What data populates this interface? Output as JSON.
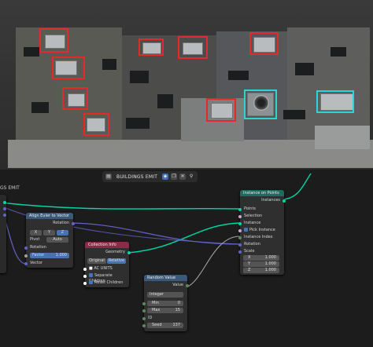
{
  "header": {
    "title": "BUILDINGS EMIT",
    "icons": [
      "node-tree-icon",
      "pin-icon",
      "shield-icon",
      "close-icon"
    ]
  },
  "left_fragment": {
    "label": "GS EMIT"
  },
  "nodes": {
    "instance_on_points": {
      "title": "Instance on Points",
      "output": "Instances",
      "inputs": [
        "Points",
        "Selection",
        "Instance",
        "Pick Instance",
        "Instance Index",
        "Rotation",
        "Scale"
      ],
      "scale": {
        "x_label": "X",
        "x": "1.000",
        "y_label": "Y",
        "y": "1.000",
        "z_label": "Z",
        "z": "1.000"
      }
    },
    "align_euler": {
      "title": "Align Euler to Vector",
      "output": "Rotation",
      "axes": [
        "X",
        "Y",
        "Z"
      ],
      "pivot_label": "Pivot",
      "pivot_value": "Auto",
      "rotation_label": "Rotation",
      "factor_label": "Factor",
      "factor_value": "1.000",
      "vector_label": "Vector"
    },
    "collection_info": {
      "title": "Collection Info",
      "output": "Geometry",
      "tabs": [
        "Original",
        "Relative"
      ],
      "collection": "AC UNITS",
      "separate_children": "Separate Children",
      "reset_children": "Reset Children"
    },
    "random_value": {
      "title": "Random Value",
      "output": "Value",
      "type": "Integer",
      "min_label": "Min",
      "min": "0",
      "max_label": "Max",
      "max": "15",
      "id_label": "ID",
      "seed_label": "Seed",
      "seed": "137"
    }
  },
  "colors": {
    "geometry_socket": "#00d6a3",
    "vector_socket": "#6363c7",
    "int_socket": "#598c5c",
    "gray_socket": "#a1a1a1",
    "collection_header": "#8b2b48",
    "util_header": "#3b5a7a",
    "instance_header": "#1f6b5e",
    "red_box": "#e12a2a",
    "cyan_box": "#2ed3d8"
  }
}
